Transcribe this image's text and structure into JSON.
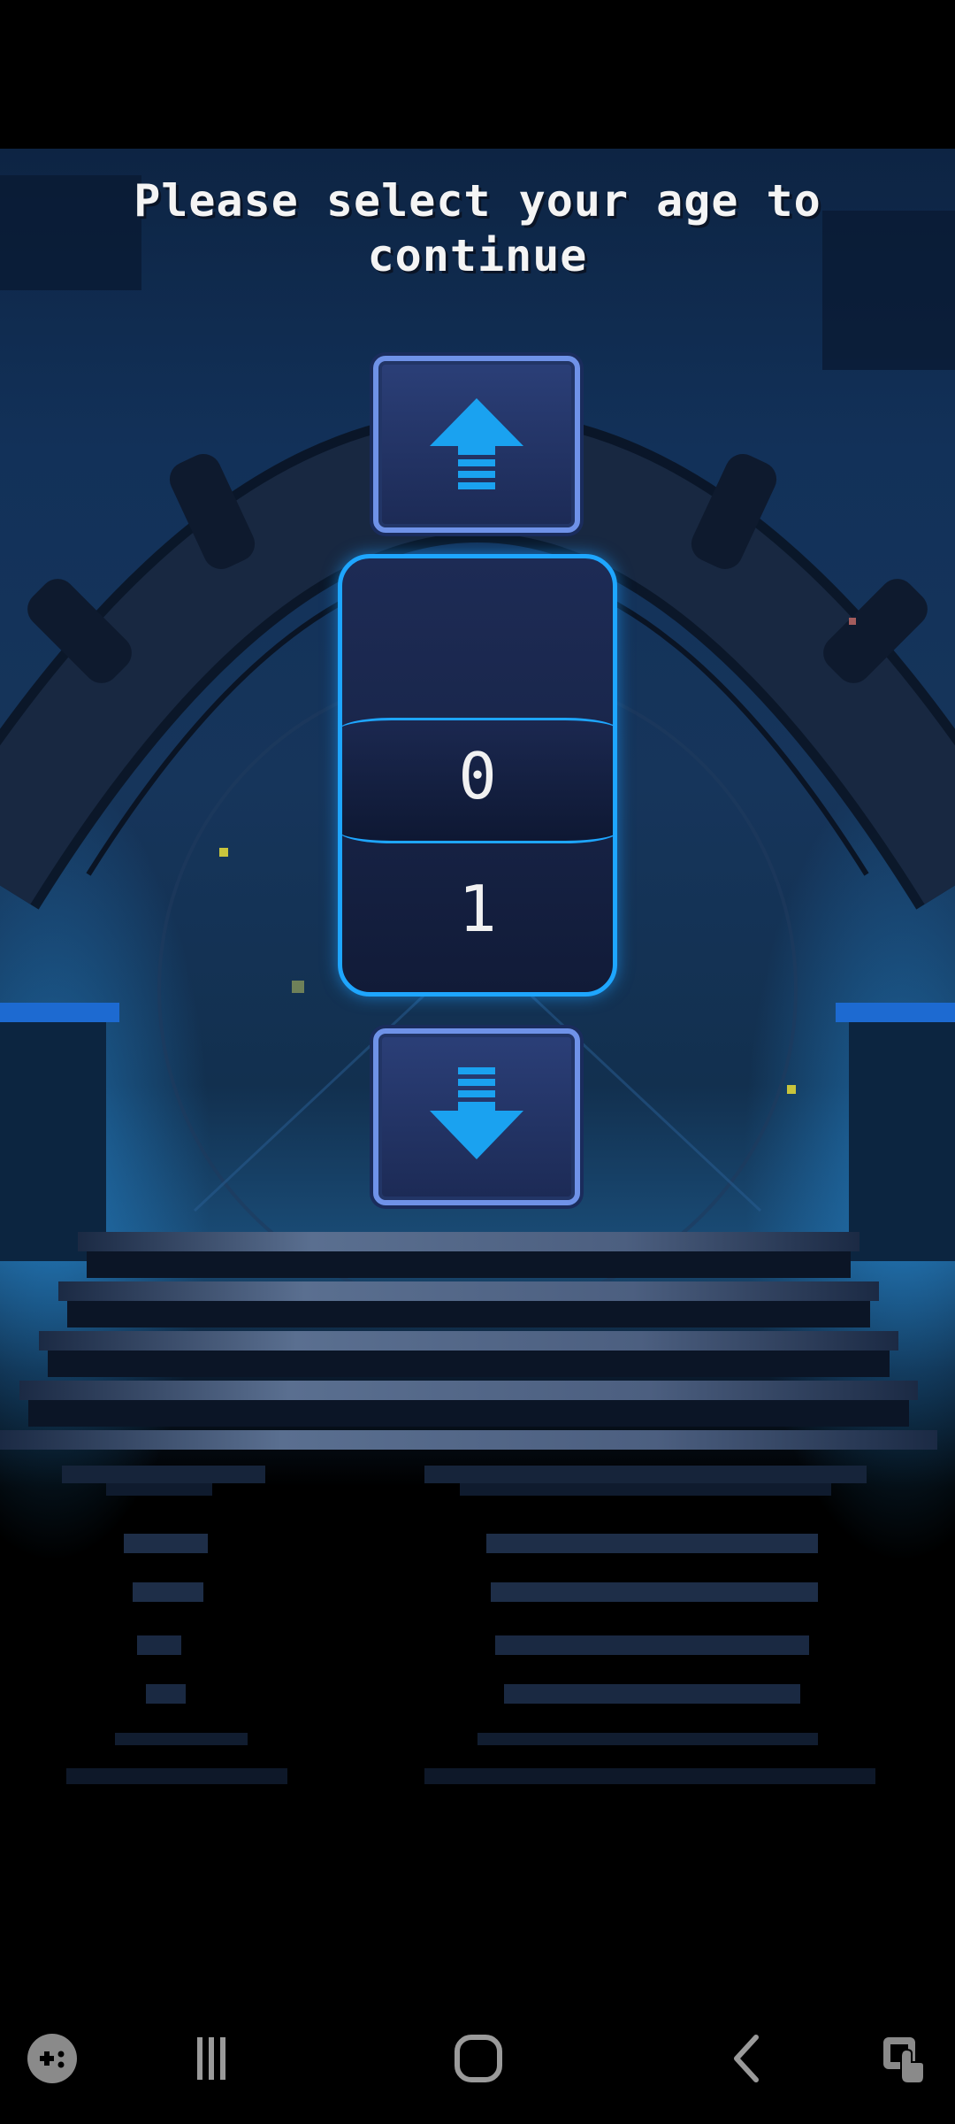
{
  "screen": {
    "prompt": "Please select your age to continue"
  },
  "age_picker": {
    "previous_value": "",
    "selected_value": "0",
    "next_value": "1",
    "up_icon": "arrow-up-icon",
    "down_icon": "arrow-down-icon",
    "accent_color": "#1ea6ff"
  },
  "navbar": {
    "icons": [
      "game-launcher-icon",
      "recent-apps-icon",
      "home-icon",
      "back-icon",
      "screen-touch-icon"
    ]
  }
}
